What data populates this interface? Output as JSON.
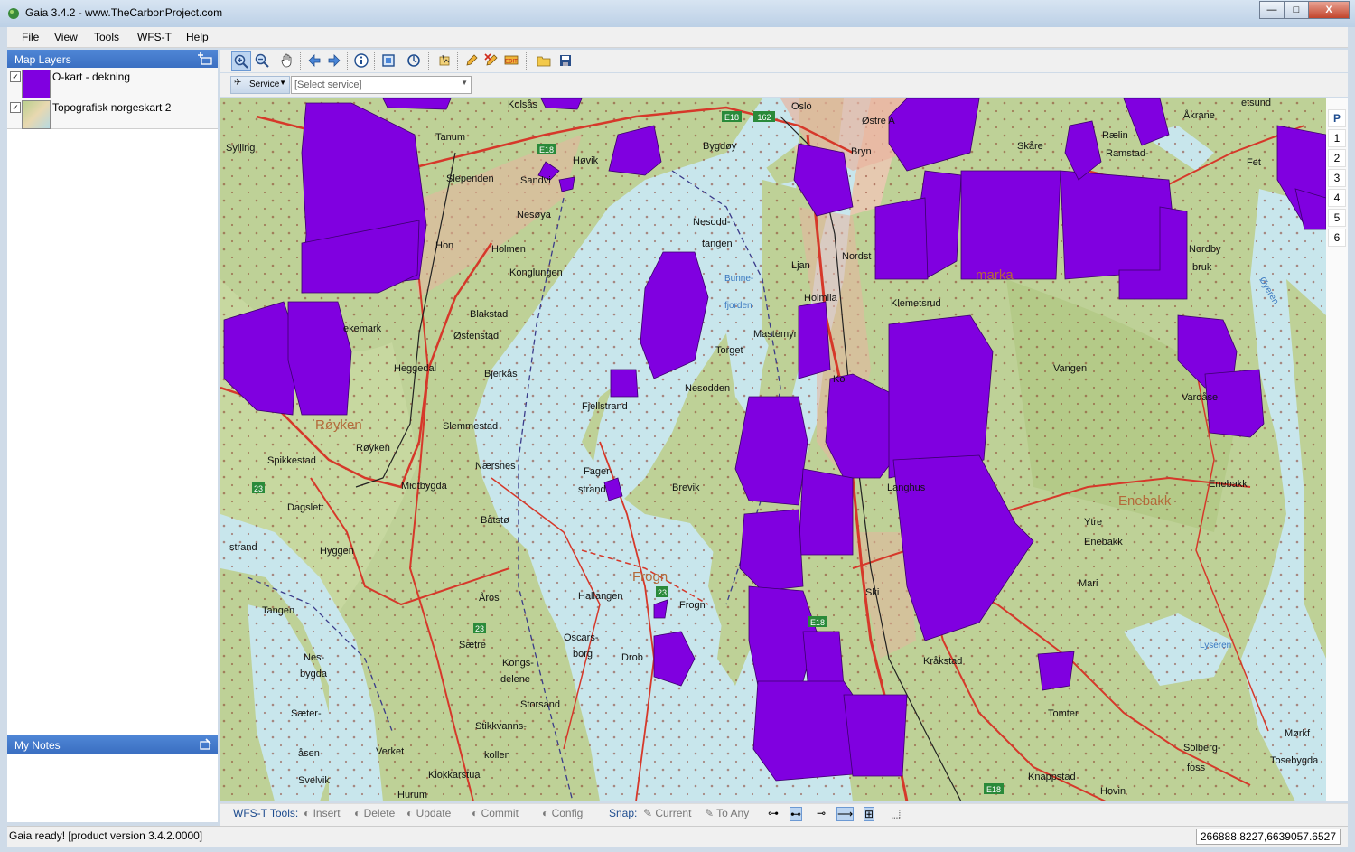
{
  "window": {
    "title": "Gaia 3.4.2 - www.TheCarbonProject.com",
    "buttons": {
      "minimize": "—",
      "maximize": "□",
      "close": "X"
    }
  },
  "menu": [
    "File",
    "View",
    "Tools",
    "WFS-T",
    "Help"
  ],
  "layers_panel": {
    "title": "Map Layers",
    "layers": [
      {
        "name": "O-kart - dekning",
        "checked": "✓",
        "swatch": "#8000e0"
      },
      {
        "name": "Topografisk norgeskart 2",
        "checked": "✓",
        "swatch": "#b9cf8d"
      }
    ]
  },
  "notes_panel": {
    "title": "My Notes"
  },
  "toolbar": {
    "service_button": "Service",
    "service_placeholder": "[Select service]",
    "icons": [
      "zoom-in-icon",
      "zoom-out-icon",
      "pan-hand-icon",
      "back-arrow-icon",
      "forward-arrow-icon",
      "info-icon",
      "full-extent-icon",
      "refresh-icon",
      "select-icon",
      "edit-pencil-icon",
      "delete-x-icon",
      "edit-text-icon",
      "open-folder-icon",
      "save-icon"
    ]
  },
  "map": {
    "overlay_color": "#8000e0",
    "labels": {
      "oslo": "Oslo",
      "tanum": "Tanum",
      "kolsas": "Kolsås",
      "sylling": "Sylling",
      "slependen": "Slependen",
      "sandvika": "Sandvi",
      "hovik": "Høvik",
      "nesoya": "Nesøya",
      "holmen": "Holmen",
      "konglungen": "Konglungen",
      "blakstad": "Blakstad",
      "ostenstad": "Østenstad",
      "heggedal": "Heggedal",
      "bjerkas": "Bjerkås",
      "royken_big": "Røyken",
      "royken": "Røyken",
      "slemmestad": "Slemmestad",
      "spikkestad": "Spikkestad",
      "naersnes": "Nærsnes",
      "midtbygda": "Midtbygda",
      "dagslett": "Dagslett",
      "batsto": "Båtstø",
      "hyggen": "Hyggen",
      "strand": "strand",
      "tangen": "Tangen",
      "nesbygda1": "Nes-",
      "nesbygda2": "bygda",
      "saeter": "Sæter-",
      "asen": "åsen",
      "svelvik": "Svelvik",
      "verket": "Verket",
      "hurum": "Hurum",
      "klokkarstua": "Klokkarstua",
      "stikkvanns": "Stikkvanns-",
      "kollen": "kollen",
      "storsand": "Storsand",
      "kongs": "Kongs-",
      "delene": "delene",
      "saetre": "Sætre",
      "aros": "Åros",
      "oscarsborg1": "Oscars-",
      "oscarsborg2": "borg",
      "hallangen": "Hallangen",
      "frogn_big": "Frogn",
      "frogn": "Frogn",
      "drob": "Drob",
      "fagerstrand1": "Fager-",
      "fagerstrand2": "strand",
      "brevik": "Brevik",
      "fjellstrand": "Fjellstrand",
      "nesodden": "Nesodden",
      "torget": "Torget",
      "nesoddtangen1": "Nesodd-",
      "nesoddtangen2": "tangen",
      "bunnefjorden1": "Bunne-",
      "bunnefjorden2": "fjorden",
      "bygdoy": "Bygdøy",
      "ljan": "Ljan",
      "holmlia": "Holmlia",
      "mastemyr": "Mastemyr",
      "nordstr": "Nordst",
      "klemetsrud": "Klemetsrud",
      "bryn": "Bryn",
      "ostre": "Østre A",
      "langhus": "Langhus",
      "ski": "Ski",
      "kraakstad": "Kråkstad",
      "ytre": "Ytre",
      "enebakk_big": "Enebakk",
      "enebakk": "Enebakk",
      "mari": "Mari",
      "lyseren": "Lyseren",
      "vangen": "Vangen",
      "vardase": "Vardåse",
      "nordby": "Nordby",
      "bruk": "bruk",
      "ramstad": "Ramstad-",
      "raeling": "Rælin",
      "skaarer": "Skåre",
      "akrane": "Åkrane",
      "fet": "Fet",
      "tomter": "Tomter",
      "knappstad": "Knappstad",
      "hovin": "Hovin",
      "solberg": "Solberg-",
      "fosse": "foss",
      "morkfo": "Mørkf",
      "tosebygda": "Tosebygda",
      "marka": "marka",
      "sund": "etsund",
      "oyeren": "Øyeren",
      "kolbotn": "Ko",
      "holmen2": "Hon",
      "hekk": "ekemark"
    }
  },
  "map_side_buttons": [
    "P",
    "1",
    "2",
    "3",
    "4",
    "5",
    "6"
  ],
  "wfs_toolbar": {
    "label": "WFS-T Tools:",
    "insert": "Insert",
    "delete": "Delete",
    "update": "Update",
    "commit": "Commit",
    "config": "Config",
    "snap_label": "Snap:",
    "current": "Current",
    "to_any": "To Any"
  },
  "status": {
    "message": "Gaia ready! [product version 3.4.2.0000]",
    "coordinates": "266888.8227,6639057.6527"
  }
}
